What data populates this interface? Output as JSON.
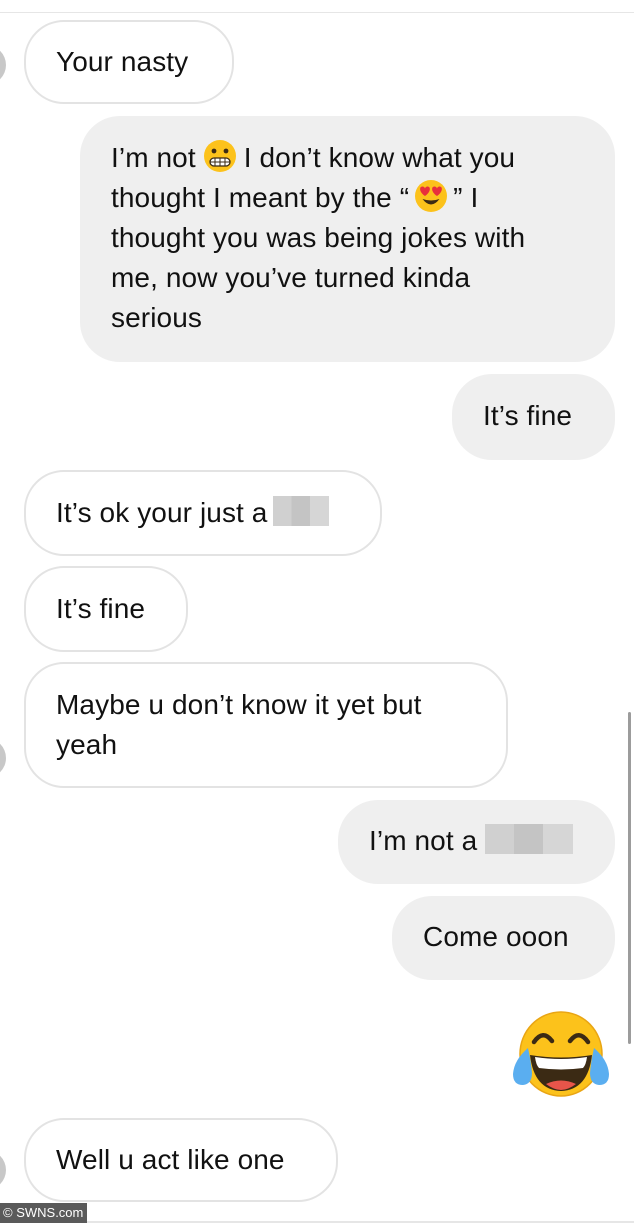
{
  "messages": [
    {
      "side": "received",
      "text": "Your nasty"
    },
    {
      "side": "sent",
      "text_before_emoji1": "I’m not",
      "text_between_emojis": "I don’t know what you thought I meant by the “",
      "text_after_emoji2": "” I thought you was being jokes with me, now you’ve turned kinda serious",
      "line1_a": "I’m not",
      "line1_b": "I don’t know what you",
      "line2_a": "thought I meant by the “",
      "line2_b": "” I",
      "line3": "thought you was being jokes with",
      "line4": "me, now you’ve turned kinda",
      "line5": "serious",
      "emoji1": "grimacing-face-emoji",
      "emoji2": "heart-eyes-emoji"
    },
    {
      "side": "sent",
      "text": "It’s fine"
    },
    {
      "side": "received",
      "text": "It’s ok your just a",
      "redacted": true
    },
    {
      "side": "received",
      "text": "It’s fine"
    },
    {
      "side": "received",
      "line1": "Maybe u don’t know it yet but",
      "line2": "yeah"
    },
    {
      "side": "sent",
      "text": "I’m not a",
      "redacted": true
    },
    {
      "side": "sent",
      "text": "Come ooon"
    },
    {
      "side": "sent",
      "emoji": "face-with-tears-of-joy-emoji"
    },
    {
      "side": "received",
      "text": "Well u act like one"
    }
  ],
  "watermark": "© SWNS.com",
  "colors": {
    "sent_bubble": "#efefef",
    "received_border": "#e3e3e3",
    "text": "#111111",
    "emoji_yellow": "#fcc21b"
  }
}
